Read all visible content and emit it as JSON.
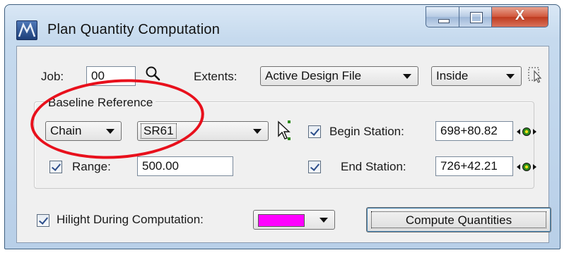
{
  "window": {
    "title": "Plan Quantity Computation",
    "close_glyph": "X"
  },
  "job": {
    "label": "Job:",
    "value": "00"
  },
  "extents": {
    "label": "Extents:",
    "selected": "Active Design File",
    "mode_selected": "Inside"
  },
  "baseline": {
    "group_label": "Baseline Reference",
    "type_selected": "Chain",
    "chain_selected": "SR61"
  },
  "range": {
    "label": "Range:",
    "value": "500.00",
    "checked": true
  },
  "begin_station": {
    "label": "Begin Station:",
    "value": "698+80.82",
    "checked": true
  },
  "end_station": {
    "label": "End Station:",
    "value": "726+42.21",
    "checked": true
  },
  "hilight": {
    "label": "Hilight During Computation:",
    "checked": true,
    "color": "#ff00ff"
  },
  "compute_button": {
    "label": "Compute Quantities"
  },
  "colors": {
    "annotation_ring": "#e8101c",
    "target_icon": "#2e8b1e"
  },
  "icons": {
    "search": "magnifier-icon",
    "select_element": "select-element-icon",
    "pick_chain": "pick-cursor-icon",
    "locate_station": "target-locate-icon"
  }
}
